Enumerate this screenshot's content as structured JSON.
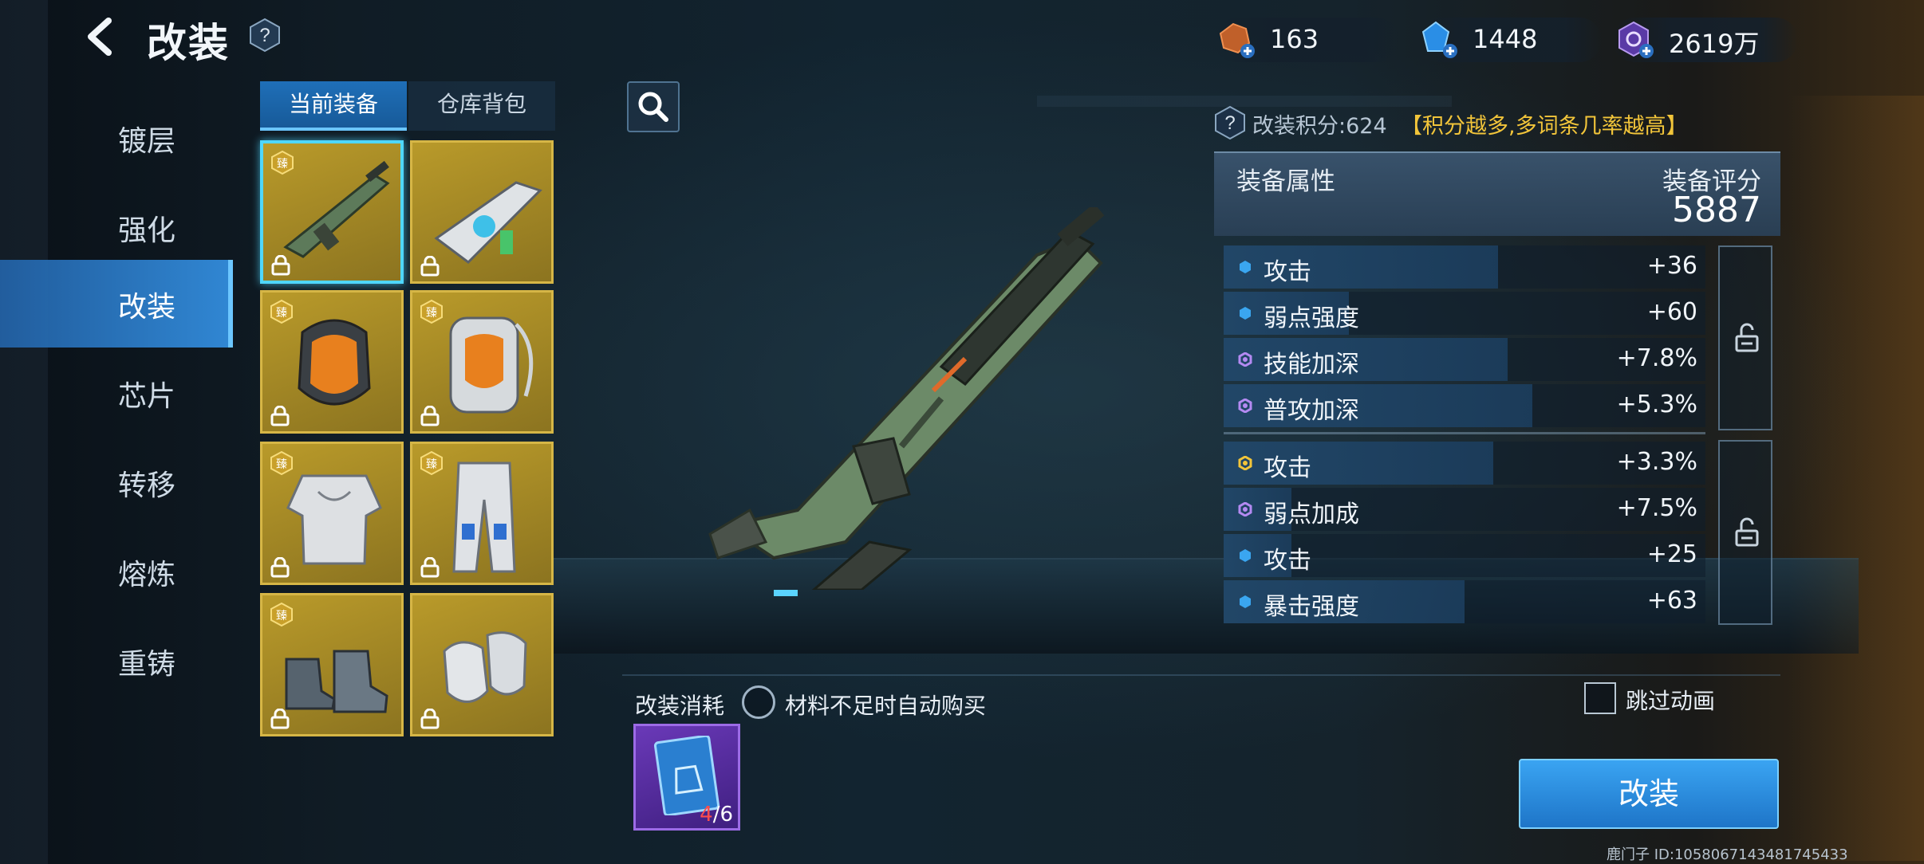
{
  "header": {
    "title": "改装",
    "back_icon": "chevron-left-icon",
    "help_icon": "question-icon"
  },
  "currencies": [
    {
      "icon": "ore-plus-icon",
      "value": "163",
      "color": "#c0602a"
    },
    {
      "icon": "blue-crystal-plus-icon",
      "value": "1448",
      "color": "#2a8ee6"
    },
    {
      "icon": "purple-core-plus-icon",
      "value": "2619万",
      "color": "#9a6de0"
    }
  ],
  "nav": {
    "items": [
      {
        "label": "镀层"
      },
      {
        "label": "强化"
      },
      {
        "label": "改装",
        "active": true
      },
      {
        "label": "芯片"
      },
      {
        "label": "转移"
      },
      {
        "label": "熔炼"
      },
      {
        "label": "重铸"
      }
    ]
  },
  "tabs": [
    {
      "label": "当前装备",
      "active": true
    },
    {
      "label": "仓库背包",
      "active": false
    }
  ],
  "search_icon": "search-icon",
  "items": [
    {
      "name": "rifle",
      "badge": "臻",
      "locked": true,
      "selected": true
    },
    {
      "name": "heavy-gun",
      "badge": "",
      "locked": true,
      "selected": false
    },
    {
      "name": "helmet",
      "badge": "臻",
      "locked": true,
      "selected": false
    },
    {
      "name": "backpack",
      "badge": "臻",
      "locked": true,
      "selected": false
    },
    {
      "name": "armor",
      "badge": "臻",
      "locked": true,
      "selected": false
    },
    {
      "name": "pants",
      "badge": "臻",
      "locked": true,
      "selected": false
    },
    {
      "name": "boots",
      "badge": "臻",
      "locked": true,
      "selected": false
    },
    {
      "name": "gloves",
      "badge": "",
      "locked": true,
      "selected": false
    }
  ],
  "panel": {
    "score_label": "改装积分:624",
    "score_hint": "【积分越多,多词条几率越高】",
    "attr_title": "装备属性",
    "rating_label": "装备评分",
    "rating_value": "5887",
    "group1": [
      {
        "dot": "blue",
        "name": "攻击",
        "value": "+36",
        "fill": 0.57
      },
      {
        "dot": "blue",
        "name": "弱点强度",
        "value": "+60",
        "fill": 0.26
      },
      {
        "dot": "purple",
        "name": "技能加深",
        "value": "+7.8%",
        "fill": 0.59
      },
      {
        "dot": "purple",
        "name": "普攻加深",
        "value": "+5.3%",
        "fill": 0.64
      }
    ],
    "group2": [
      {
        "dot": "gold",
        "name": "攻击",
        "value": "+3.3%",
        "fill": 0.56
      },
      {
        "dot": "purple",
        "name": "弱点加成",
        "value": "+7.5%",
        "fill": 0.14
      },
      {
        "dot": "blue",
        "name": "攻击",
        "value": "+25",
        "fill": 0.14
      },
      {
        "dot": "blue",
        "name": "暴击强度",
        "value": "+63",
        "fill": 0.5
      }
    ],
    "lock_icon": "unlock-icon"
  },
  "bottom": {
    "cost_label": "改装消耗",
    "auto_buy_label": "材料不足时自动购买",
    "material_icon": "mod-card-icon",
    "material_have": "4",
    "material_need": "/6",
    "skip_label": "跳过动画",
    "mod_button": "改装",
    "footer_id": "鹿门子  ID:1058067143481745433"
  }
}
